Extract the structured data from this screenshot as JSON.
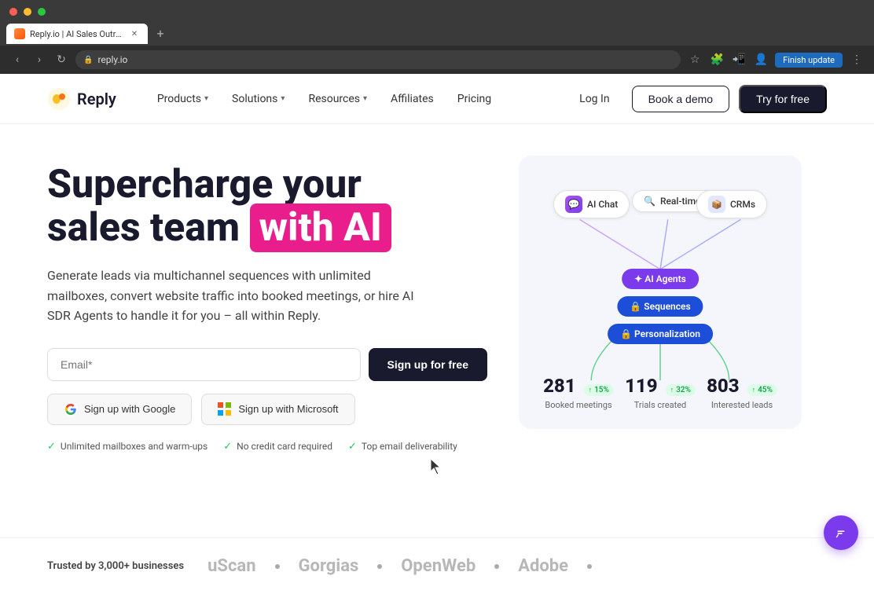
{
  "browser": {
    "tab_title": "Reply.io | AI Sales Outreach ...",
    "tab_favicon": "🟠",
    "url": "reply.io",
    "finish_update": "Finish update"
  },
  "navbar": {
    "logo_text": "Reply",
    "products_label": "Products",
    "solutions_label": "Solutions",
    "resources_label": "Resources",
    "affiliates_label": "Affiliates",
    "pricing_label": "Pricing",
    "login_label": "Log In",
    "demo_label": "Book a demo",
    "free_label": "Try for free"
  },
  "hero": {
    "title_part1": "Supercharge your",
    "title_part2": "sales team",
    "title_highlight": "with AI",
    "subtitle": "Generate leads via multichannel sequences with unlimited mailboxes, convert website traffic into booked meetings, or hire AI SDR Agents to handle it for you – all within Reply.",
    "email_placeholder": "Email*",
    "signup_btn": "Sign up for free",
    "google_btn": "Sign up with Google",
    "microsoft_btn": "Sign up with Microsoft",
    "feature1": "Unlimited mailboxes and warm-ups",
    "feature2": "No credit card required",
    "feature3": "Top email deliverability"
  },
  "diagram": {
    "node_ai_chat": "AI Chat",
    "node_realtime": "Real-time data search",
    "node_crms": "CRMs",
    "node_ai_agents": "✦ AI Agents",
    "node_sequences": "🔒 Sequences",
    "node_personal": "🔒 Personalization"
  },
  "stats": {
    "meetings": {
      "number": "281",
      "badge": "↑ 15%",
      "label": "Booked meetings"
    },
    "trials": {
      "number": "119",
      "badge": "↑ 32%",
      "label": "Trials created"
    },
    "leads": {
      "number": "803",
      "badge": "↑ 45%",
      "label": "Interested leads"
    }
  },
  "trusted": {
    "label": "Trusted by 3,000+ businesses",
    "brands": [
      "uScan",
      "Gorgias",
      "OpenWeb",
      "Adobe"
    ]
  },
  "chat_widget": {
    "icon": "💬"
  }
}
